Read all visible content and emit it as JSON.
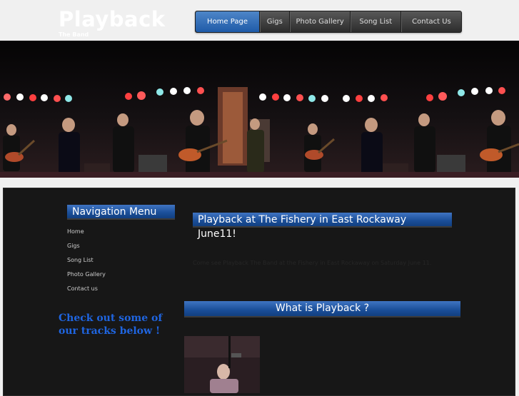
{
  "header": {
    "logo": "Playback",
    "tagline": "The Band"
  },
  "nav": {
    "items": [
      "Home Page",
      "Gigs",
      "Photo Gallery",
      "Song List",
      "Contact Us"
    ],
    "active_index": 0
  },
  "sidebar": {
    "heading": "Navigation Menu",
    "links": [
      "Home",
      "Gigs",
      "Song List",
      "Photo Gallery",
      "Contact us"
    ],
    "tracks_text": "Check out some of our tracks below !"
  },
  "post": {
    "title_line1": "Playback at The Fishery in East Rockaway",
    "title_line2": "June11!",
    "body": "Come see Playback The Band at the Fishery in East Rockaway on Saturday June 11."
  },
  "what": {
    "title": "What is Playback ?"
  },
  "colors": {
    "accent_blue": "#1f5ba8",
    "tracks_link": "#1f65e0",
    "main_bg": "#171717"
  }
}
